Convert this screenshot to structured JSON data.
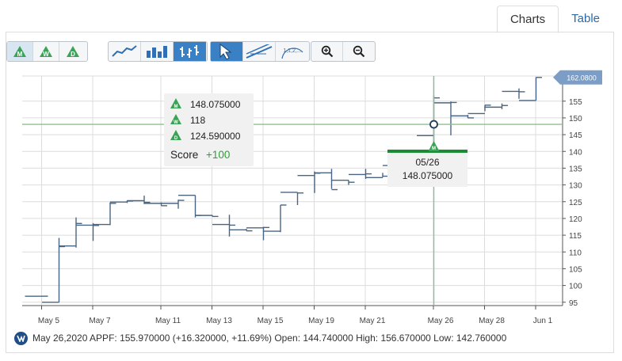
{
  "tabs": [
    {
      "label": "Charts",
      "active": true
    },
    {
      "label": "Table",
      "active": false
    }
  ],
  "toolbar": {
    "periods": [
      {
        "letter": "M",
        "label": "Monthly",
        "active": true
      },
      {
        "letter": "W",
        "label": "Weekly",
        "active": false
      },
      {
        "letter": "D",
        "label": "Daily",
        "active": false
      }
    ],
    "chart_types": [
      "line-chart-icon",
      "bar-chart-icon",
      "ohlc-chart-icon"
    ],
    "active_chart_type": "ohlc-chart-icon",
    "tools": [
      "pointer-icon",
      "trendline-icon",
      "fibonacci-icon"
    ],
    "fib_label": "1,1,2,...",
    "zoom": [
      "zoom-in-icon",
      "zoom-out-icon"
    ]
  },
  "chart_data": {
    "type": "ohlc",
    "x_ticks": [
      "May 5",
      "May 7",
      "May 11",
      "May 13",
      "May 15",
      "May 19",
      "May 21",
      "May 26",
      "May 28",
      "Jun 1"
    ],
    "y_ticks": [
      95,
      100,
      105,
      110,
      115,
      120,
      125,
      130,
      135,
      140,
      145,
      150,
      155
    ],
    "ylim": [
      94,
      162.5
    ],
    "grid": true,
    "bars": [
      {
        "open": 96.8,
        "high": 96.8,
        "low": 96.8,
        "close": 96.8
      },
      {
        "open": 95.0,
        "high": 114.2,
        "low": 95.0,
        "close": 111.6
      },
      {
        "open": 111.8,
        "high": 120.3,
        "low": 111.3,
        "close": 118.5
      },
      {
        "open": 118.0,
        "high": 118.6,
        "low": 113.3,
        "close": 117.9
      },
      {
        "open": 118.2,
        "high": 124.8,
        "low": 118.0,
        "close": 124.5
      },
      {
        "open": 124.9,
        "high": 125.4,
        "low": 124.6,
        "close": 125.2
      },
      {
        "open": 125.3,
        "high": 126.8,
        "low": 124.3,
        "close": 124.8
      },
      {
        "open": 124.5,
        "high": 124.8,
        "low": 123.8,
        "close": 123.8
      },
      {
        "open": 124.5,
        "high": 125.6,
        "low": 122.9,
        "close": 125.4
      },
      {
        "open": 126.9,
        "high": 126.9,
        "low": 120.3,
        "close": 120.9
      },
      {
        "open": 120.9,
        "high": 121.0,
        "low": 120.6,
        "close": 120.6
      },
      {
        "open": 118.2,
        "high": 121.1,
        "low": 114.6,
        "close": 118.0
      },
      {
        "open": 116.6,
        "high": 116.9,
        "low": 116.3,
        "close": 116.3
      },
      {
        "open": 117.2,
        "high": 117.5,
        "low": 113.5,
        "close": 117.3
      },
      {
        "open": 116.2,
        "high": 124.0,
        "low": 115.9,
        "close": 124.0
      },
      {
        "open": 127.8,
        "high": 127.8,
        "low": 124.0,
        "close": 127.6
      },
      {
        "open": 132.8,
        "high": 134.0,
        "low": 127.6,
        "close": 133.5
      },
      {
        "open": 133.6,
        "high": 134.8,
        "low": 128.8,
        "close": 128.6
      },
      {
        "open": 131.4,
        "high": 131.4,
        "low": 130.0,
        "close": 130.8
      },
      {
        "open": 133.1,
        "high": 134.8,
        "low": 131.8,
        "close": 133.3
      },
      {
        "open": 132.2,
        "high": 133.6,
        "low": 132.3,
        "close": 132.6
      },
      {
        "open": 135.8,
        "high": 137.3,
        "low": 134.5,
        "close": 136.2
      },
      {
        "open": 139.4,
        "high": 139.4,
        "low": 138.9,
        "close": 139.4
      },
      {
        "open": 144.7,
        "high": 156.7,
        "low": 142.8,
        "close": 155.97
      },
      {
        "open": 154.5,
        "high": 154.9,
        "low": 144.8,
        "close": 154.6
      },
      {
        "open": 150.6,
        "high": 150.9,
        "low": 149.9,
        "close": 150.0
      },
      {
        "open": 151.3,
        "high": 153.8,
        "low": 152.0,
        "close": 153.8
      },
      {
        "open": 153.2,
        "high": 154.3,
        "low": 152.6,
        "close": 153.7
      },
      {
        "open": 157.9,
        "high": 158.8,
        "low": 155.7,
        "close": 157.8
      },
      {
        "open": 155.2,
        "high": 162.1,
        "low": 155.2,
        "close": 162.08
      }
    ],
    "last_price_label": "162.0800",
    "crosshair": {
      "bar_index": 23,
      "value": 148.075
    },
    "crosshair_label": {
      "date": "05/26",
      "value": "148.075000"
    },
    "tooltip": {
      "rows": [
        {
          "letter": "M",
          "value": "148.075000"
        },
        {
          "letter": "W",
          "value": "118"
        },
        {
          "letter": "D",
          "value": "124.590000"
        }
      ],
      "score_label": "Score",
      "score_value": "+100"
    }
  },
  "footer": {
    "text": "May 26,2020 APPF: 155.970000 (+16.320000, +11.69%) Open: 144.740000 High: 156.670000 Low: 142.760000"
  },
  "colors": {
    "bar": "#4a6583",
    "grid": "#dcdcdc",
    "crosshair": "#8fc08a",
    "price_label_bg": "#7b9dc6",
    "score_green": "#2e9e3a",
    "signal_green": "#1b8a35",
    "tab_blue": "#2a6aa8"
  }
}
